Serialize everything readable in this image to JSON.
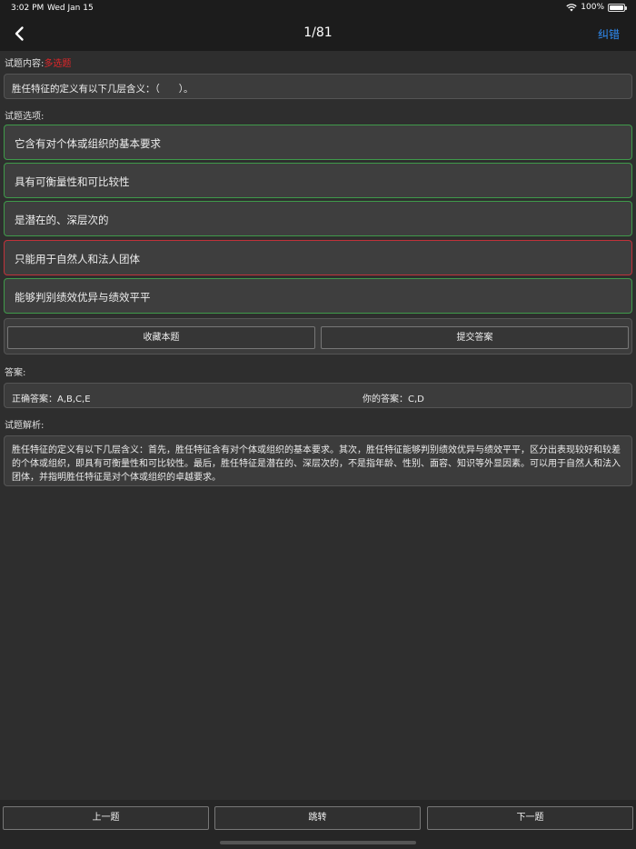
{
  "status": {
    "time": "3:02 PM",
    "date": "Wed Jan 15",
    "battery": "100%",
    "battery_level": 1.0
  },
  "nav": {
    "title": "1/81",
    "action": "纠错"
  },
  "question": {
    "label": "试题内容:",
    "type_tag": "多选题",
    "text": "胜任特征的定义有以下几层含义：（　　）。"
  },
  "options_label": "试题选项:",
  "options": [
    {
      "text": "它含有对个体或组织的基本要求",
      "state": "correct"
    },
    {
      "text": "具有可衡量性和可比较性",
      "state": "correct"
    },
    {
      "text": "是潜在的、深层次的",
      "state": "correct"
    },
    {
      "text": "只能用于自然人和法人团体",
      "state": "wrong"
    },
    {
      "text": "能够判别绩效优异与绩效平平",
      "state": "correct"
    }
  ],
  "actions": {
    "favorite": "收藏本题",
    "submit": "提交答案"
  },
  "answer": {
    "label": "答案:",
    "correct_label": "正确答案：",
    "correct_value": "A,B,C,E",
    "yours_label": "你的答案：",
    "yours_value": "C,D"
  },
  "analysis": {
    "label": "试题解析:",
    "text": "胜任特征的定义有以下几层含义：首先，胜任特征含有对个体或组织的基本要求。其次，胜任特征能够判别绩效优异与绩效平平，区分出表现较好和较差的个体或组织，即具有可衡量性和可比较性。最后，胜任特征是潜在的、深层次的，不是指年龄、性别、面容、知识等外显因素。可以用于自然人和法入团体，并指明胜任特征是对个体或组织的卓越要求。"
  },
  "footer": {
    "prev": "上一题",
    "jump": "跳转",
    "next": "下一题"
  },
  "colors": {
    "accent": "#2f8cf4",
    "correct_border": "#3f9a4a",
    "wrong_border": "#c0323a",
    "tag": "#e0262a"
  }
}
